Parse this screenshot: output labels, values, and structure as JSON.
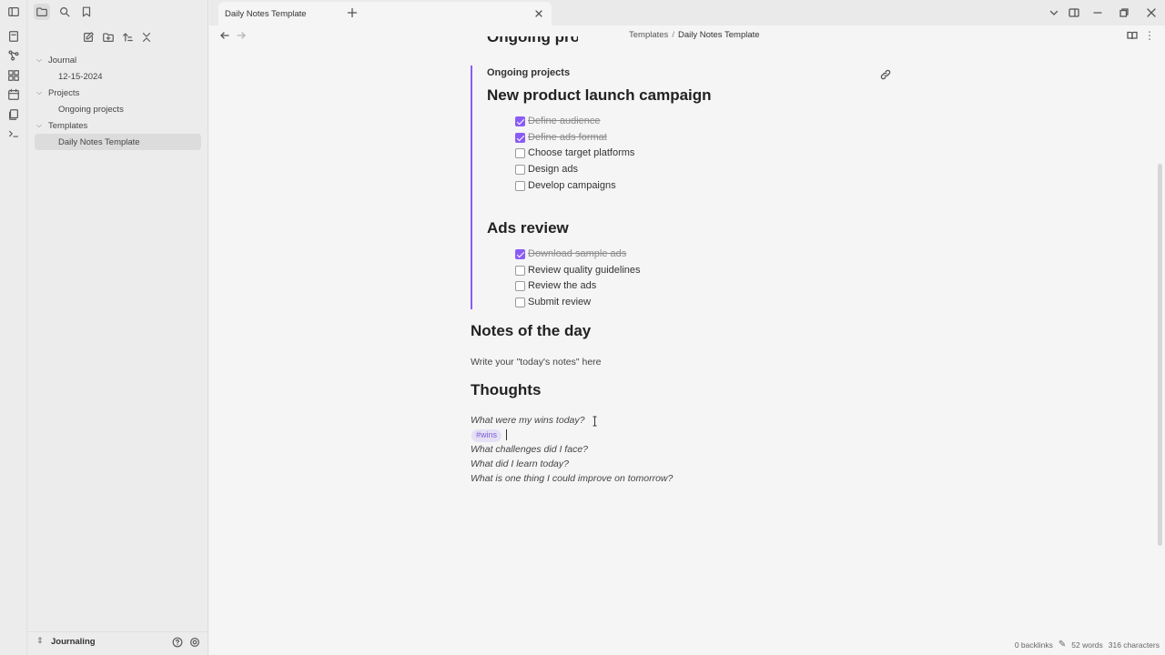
{
  "tabs": [
    {
      "label": "Daily Notes Template"
    }
  ],
  "breadcrumb": {
    "folder": "Templates",
    "separator": "/",
    "current": "Daily Notes Template"
  },
  "file_tree": [
    {
      "label": "Journal",
      "type": "folder"
    },
    {
      "label": "12-15-2024",
      "type": "file"
    },
    {
      "label": "Projects",
      "type": "folder"
    },
    {
      "label": "Ongoing projects",
      "type": "file"
    },
    {
      "label": "Templates",
      "type": "folder"
    },
    {
      "label": "Daily Notes Template",
      "type": "file",
      "selected": true
    }
  ],
  "vault": {
    "name": "Journaling"
  },
  "note": {
    "clipped_heading": "Ongoing projects",
    "embed_title": "Ongoing projects",
    "section1": {
      "title": "New product launch campaign",
      "tasks": [
        {
          "label": "Define audience",
          "done": true
        },
        {
          "label": "Define ads format",
          "done": true
        },
        {
          "label": "Choose target platforms",
          "done": false
        },
        {
          "label": "Design ads",
          "done": false
        },
        {
          "label": "Develop campaigns",
          "done": false
        }
      ]
    },
    "section2": {
      "title": "Ads review",
      "tasks": [
        {
          "label": "Download sample ads",
          "done": true
        },
        {
          "label": "Review quality guidelines",
          "done": false
        },
        {
          "label": "Review the ads",
          "done": false
        },
        {
          "label": "Submit review",
          "done": false
        }
      ]
    },
    "notes_heading": "Notes of the day",
    "notes_text": "Write your \"today's notes\" here",
    "thoughts_heading": "Thoughts",
    "questions": [
      "What were my wins today?",
      "What challenges did I face?",
      "What did I learn today?",
      "What is one thing I could improve on tomorrow?"
    ],
    "tag": "#wins"
  },
  "status": {
    "backlinks": "0 backlinks",
    "words": "52 words",
    "characters": "316 characters"
  },
  "colors": {
    "accent": "#8a5cf5",
    "tag_bg": "#e6e0f5"
  }
}
